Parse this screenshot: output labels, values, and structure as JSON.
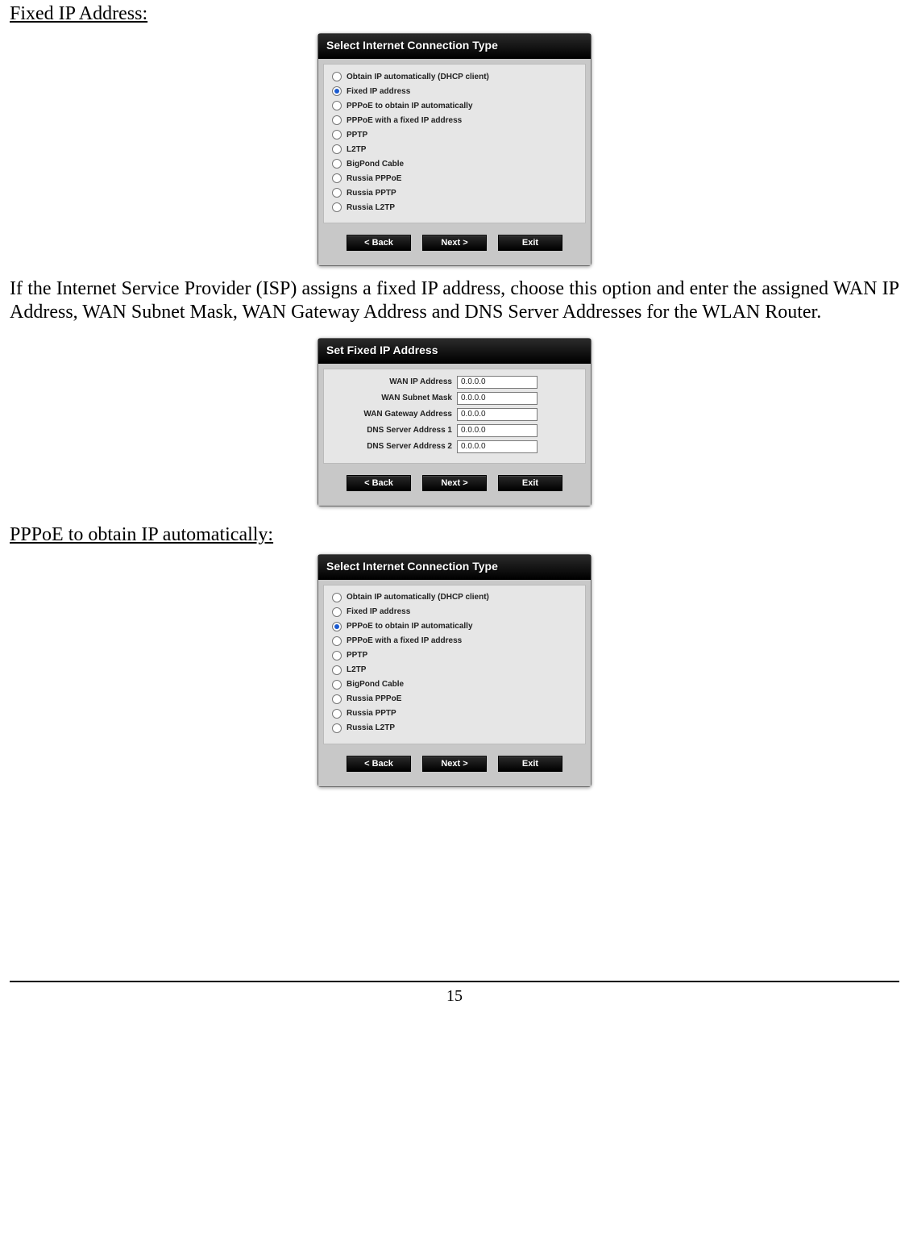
{
  "headings": {
    "fixed_ip": "Fixed IP Address:",
    "pppoe_auto": "PPPoE to obtain IP automatically:"
  },
  "paragraphs": {
    "fixed_ip_body": "If the Internet Service Provider (ISP) assigns a fixed IP address, choose this option and enter the assigned WAN IP Address, WAN Subnet Mask, WAN Gateway Address and DNS Server Addresses for the WLAN Router."
  },
  "dialog1": {
    "title": "Select Internet Connection Type",
    "options": [
      "Obtain IP automatically (DHCP client)",
      "Fixed IP address",
      "PPPoE to obtain IP automatically",
      "PPPoE with a fixed IP address",
      "PPTP",
      "L2TP",
      "BigPond Cable",
      "Russia PPPoE",
      "Russia PPTP",
      "Russia L2TP"
    ],
    "selected_index": 1
  },
  "dialog2": {
    "title": "Set Fixed IP Address",
    "fields": [
      {
        "label": "WAN IP Address",
        "value": "0.0.0.0"
      },
      {
        "label": "WAN Subnet Mask",
        "value": "0.0.0.0"
      },
      {
        "label": "WAN Gateway Address",
        "value": "0.0.0.0"
      },
      {
        "label": "DNS Server Address 1",
        "value": "0.0.0.0"
      },
      {
        "label": "DNS Server Address 2",
        "value": "0.0.0.0"
      }
    ]
  },
  "dialog3": {
    "title": "Select Internet Connection Type",
    "options": [
      "Obtain IP automatically (DHCP client)",
      "Fixed IP address",
      "PPPoE to obtain IP automatically",
      "PPPoE with a fixed IP address",
      "PPTP",
      "L2TP",
      "BigPond Cable",
      "Russia PPPoE",
      "Russia PPTP",
      "Russia L2TP"
    ],
    "selected_index": 2
  },
  "buttons": {
    "back": "<  Back",
    "next": "Next  >",
    "exit": "Exit"
  },
  "page_number": "15"
}
